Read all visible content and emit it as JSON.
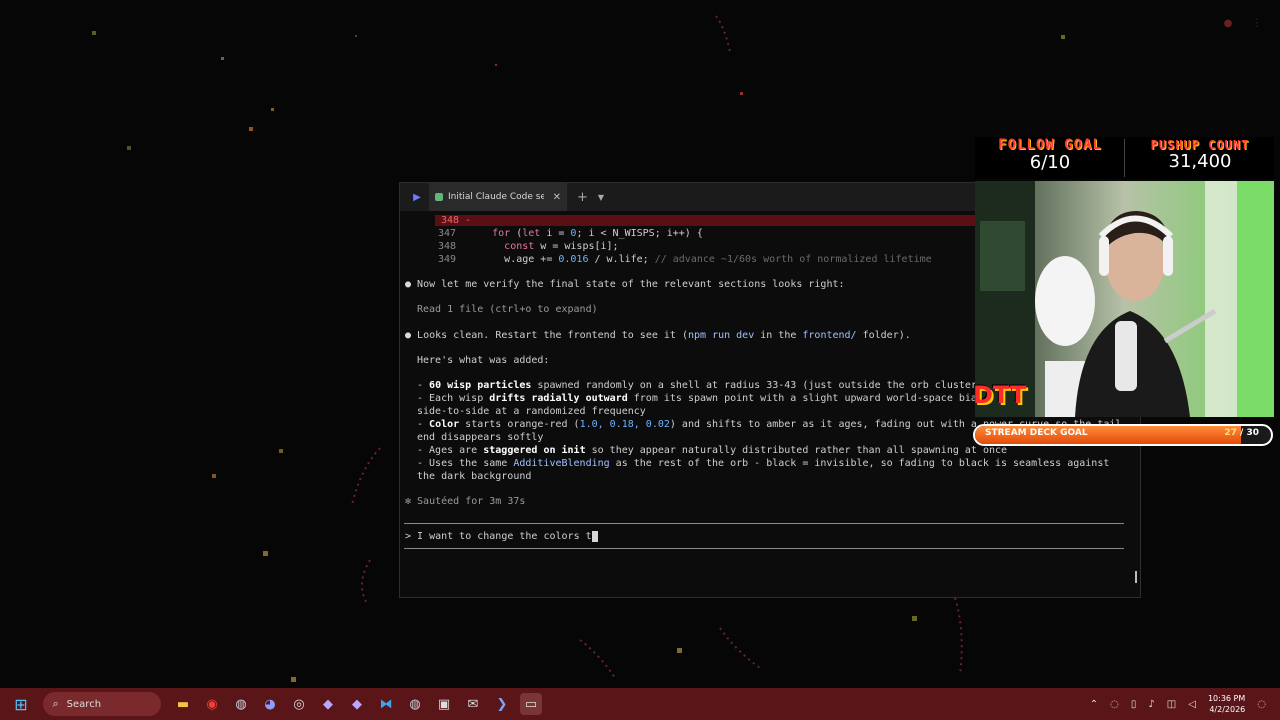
{
  "terminal": {
    "app_icon": "powershell-icon",
    "tab_title": "Initial Claude Code session",
    "tab_icon": "claude-icon",
    "lines": {
      "diff_num": "348 -",
      "l347_num": "347",
      "l347_kw": "for",
      "l347_a": " (",
      "l347_kw2": "let",
      "l347_b": " i = ",
      "l347_n": "0",
      "l347_c": "; i < N_WISPS; i++) {",
      "l348_num": "348",
      "l348_kw": "const",
      "l348_a": " w = wisps[i];",
      "l349_num": "349",
      "l349_a": "w.age += ",
      "l349_n": "0.016",
      "l349_b": " / w.life; ",
      "l349_cm": "// advance ~1/60s worth of normalized lifetime",
      "verify": "Now let me verify the final state of the relevant sections looks right:",
      "read": "Read 1 file (ctrl+o to expand)",
      "clean_a": "Looks clean. Restart the frontend to see it (",
      "clean_cmd": "npm run dev",
      "clean_b": " in the ",
      "clean_dir": "frontend/",
      "clean_c": " folder).",
      "added": "Here's what was added:",
      "b1_a": "- ",
      "b1_b": "60 wisp particles",
      "b1_c": " spawned randomly on a shell at radius 33-43 (just outside the orb cluster",
      "b2_a": "- Each wisp ",
      "b2_b": "drifts radially outward",
      "b2_c": " from its spawn point with a slight upward world-space bia",
      "b2_d": "side-to-side at a randomized frequency",
      "b3_a": "- ",
      "b3_b": "Color",
      "b3_c": " starts orange-red (",
      "b3_n": "1.0, 0.18, 0.02",
      "b3_d": ") and shifts to amber as it ages, fading out with a power curve so the tail",
      "b3_e": "end disappears softly",
      "b4_a": "- Ages are ",
      "b4_b": "staggered on init",
      "b4_c": " so they appear naturally distributed rather than all spawning at once",
      "b5_a": "- Uses the same ",
      "b5_b": "AdditiveBlending",
      "b5_c": " as the rest of the orb - black = invisible, so fading to black is seamless against",
      "b5_d": "the dark background",
      "sauteed": "✻ Sautéed for 3m 37s",
      "prompt": "> I want to change the colors t"
    }
  },
  "overlay": {
    "follow_goal_title": "FOLLOW GOAL",
    "follow_goal_value": "6/10",
    "pushup_title": "PUSHUP COUNT",
    "pushup_value": "31,400",
    "stream_deck_label": "STREAM DECK GOAL",
    "stream_deck_current": "27",
    "stream_deck_sep": " / ",
    "stream_deck_target": "30",
    "stream_deck_progress": 0.9,
    "badge_text": "DTT"
  },
  "taskbar": {
    "search_placeholder": "Search",
    "time": "10:36 PM",
    "date": "4/2/2026",
    "apps": [
      "windows-start-icon",
      "file-explorer-icon",
      "chrome-icon",
      "steam-icon",
      "discord-icon",
      "obs-icon",
      "app-diamond-icon",
      "app-diamond-2-icon",
      "vscode-icon",
      "steam-2-icon",
      "app-box-icon",
      "mail-icon",
      "powershell-icon",
      "terminal-icon"
    ]
  },
  "colors": {
    "accent_red": "#ff3b3b",
    "taskbar": "#5a1518",
    "terminal_bg": "#0c0c0c",
    "goal_fill": "#e24b0a"
  }
}
